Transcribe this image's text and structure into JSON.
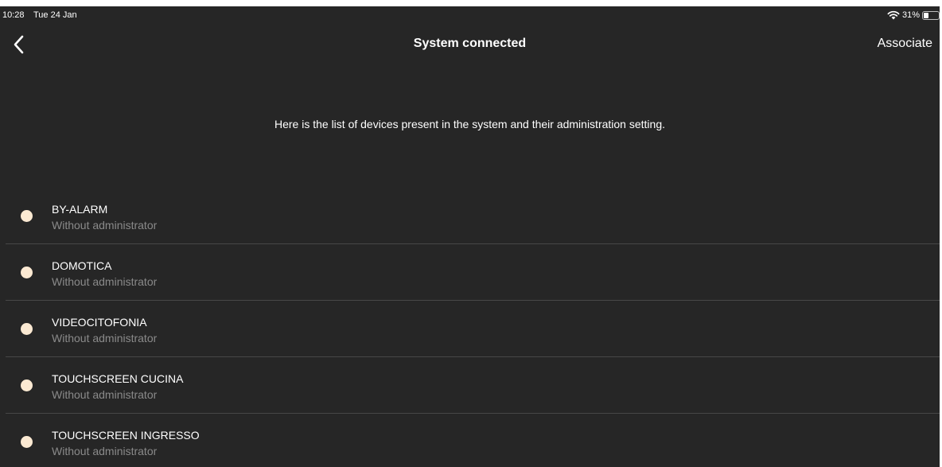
{
  "status_bar": {
    "time": "10:28",
    "date": "Tue 24 Jan",
    "battery_percent": "31%",
    "battery_level": 0.31,
    "wifi_icon": "wifi-icon",
    "battery_icon": "battery-icon"
  },
  "nav": {
    "back_icon": "chevron-left-icon",
    "title": "System connected",
    "associate_label": "Associate"
  },
  "description": "Here is the list of devices present in the system and their administration setting.",
  "colors": {
    "background": "#262626",
    "status_dot": "#fbe9d2",
    "secondary_text": "#8a8a8a",
    "divider": "#474747"
  },
  "devices": [
    {
      "name": "BY-ALARM",
      "status": "Without administrator"
    },
    {
      "name": "DOMOTICA",
      "status": "Without administrator"
    },
    {
      "name": "VIDEOCITOFONIA",
      "status": "Without administrator"
    },
    {
      "name": "TOUCHSCREEN CUCINA",
      "status": "Without administrator"
    },
    {
      "name": "TOUCHSCREEN INGRESSO",
      "status": "Without administrator"
    }
  ]
}
